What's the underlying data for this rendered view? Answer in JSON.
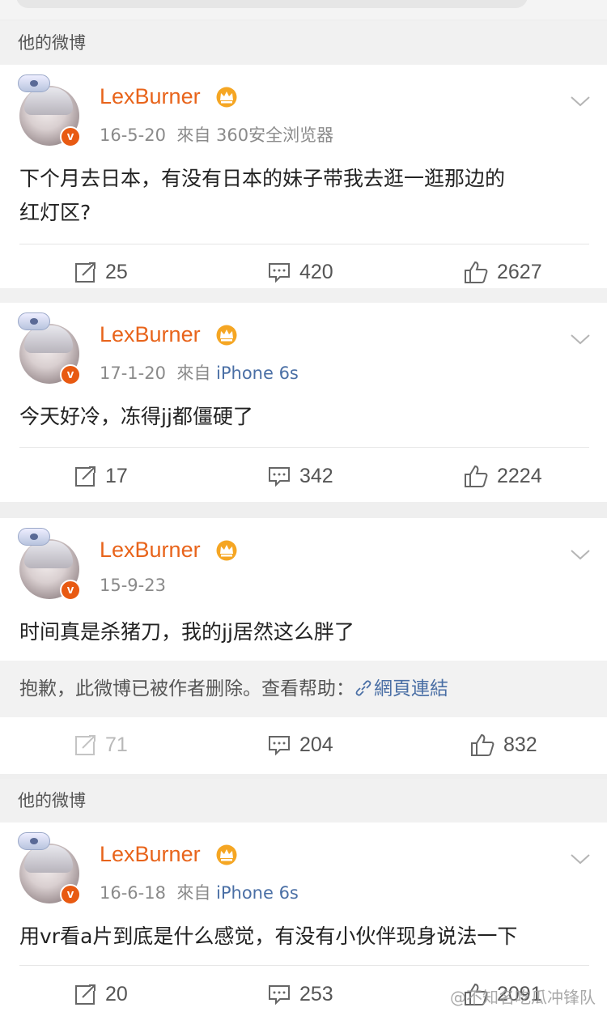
{
  "section_label": "他的微博",
  "posts": [
    {
      "username": "LexBurner",
      "date": "16-5-20",
      "source_prefix": "來自",
      "source": "360安全浏览器",
      "text_line1": "下个月去日本，有没有日本的妹子带我去逛一逛那边的",
      "text_line2": "红灯区?",
      "repost": "25",
      "comment": "420",
      "like": "2627"
    },
    {
      "username": "LexBurner",
      "date": "17-1-20",
      "source_prefix": "來自",
      "source": "iPhone 6s",
      "text_line1": "今天好冷，冻得jj都僵硬了",
      "repost": "17",
      "comment": "342",
      "like": "2224"
    },
    {
      "username": "LexBurner",
      "date": "15-9-23",
      "text_line1": "时间真是杀猪刀，我的jj居然这么胖了",
      "deleted_notice": "抱歉，此微博已被作者删除。查看帮助：",
      "help_link": "網頁連結",
      "repost": "71",
      "comment": "204",
      "like": "832"
    },
    {
      "username": "LexBurner",
      "date": "16-6-18",
      "source_prefix": "來自",
      "source": "iPhone 6s",
      "text_line1": "用vr看a片到底是什么感觉，有没有小伙伴现身说法一下",
      "repost": "20",
      "comment": "253",
      "like": "2091"
    }
  ],
  "watermark": "@不知名吃瓜冲锋队",
  "colors": {
    "username": "#e8641b",
    "link": "#4a6fa5",
    "badge": "#e85a12",
    "crown": "#f5a623"
  },
  "icons": [
    "repost-icon",
    "comment-icon",
    "like-icon",
    "crown-icon",
    "verified-v-icon",
    "chevron-down-icon",
    "link-icon"
  ]
}
